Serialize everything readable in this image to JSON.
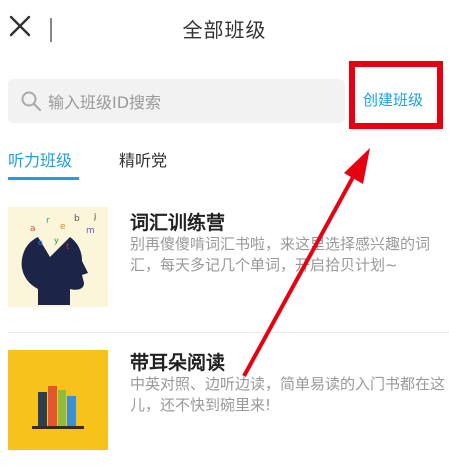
{
  "header": {
    "title": "全部班级"
  },
  "search": {
    "placeholder": "输入班级ID搜索"
  },
  "create_button": {
    "label": "创建班级"
  },
  "tabs": [
    {
      "label": "听力班级",
      "active": true
    },
    {
      "label": "精听党",
      "active": false
    }
  ],
  "courses": [
    {
      "title": "词汇训练营",
      "description": "别再傻傻啃词汇书啦，来这里选择感兴趣的词汇，每天多记几个单词，开启拾贝计划~"
    },
    {
      "title": "带耳朵阅读",
      "description": "中英对照、边听边读，简单易读的入门书都在这儿，还不快到碗里来!"
    }
  ],
  "colors": {
    "accent": "#1e9fe0",
    "highlight": "#e60012"
  },
  "icons": [
    "close-icon",
    "search-icon"
  ]
}
